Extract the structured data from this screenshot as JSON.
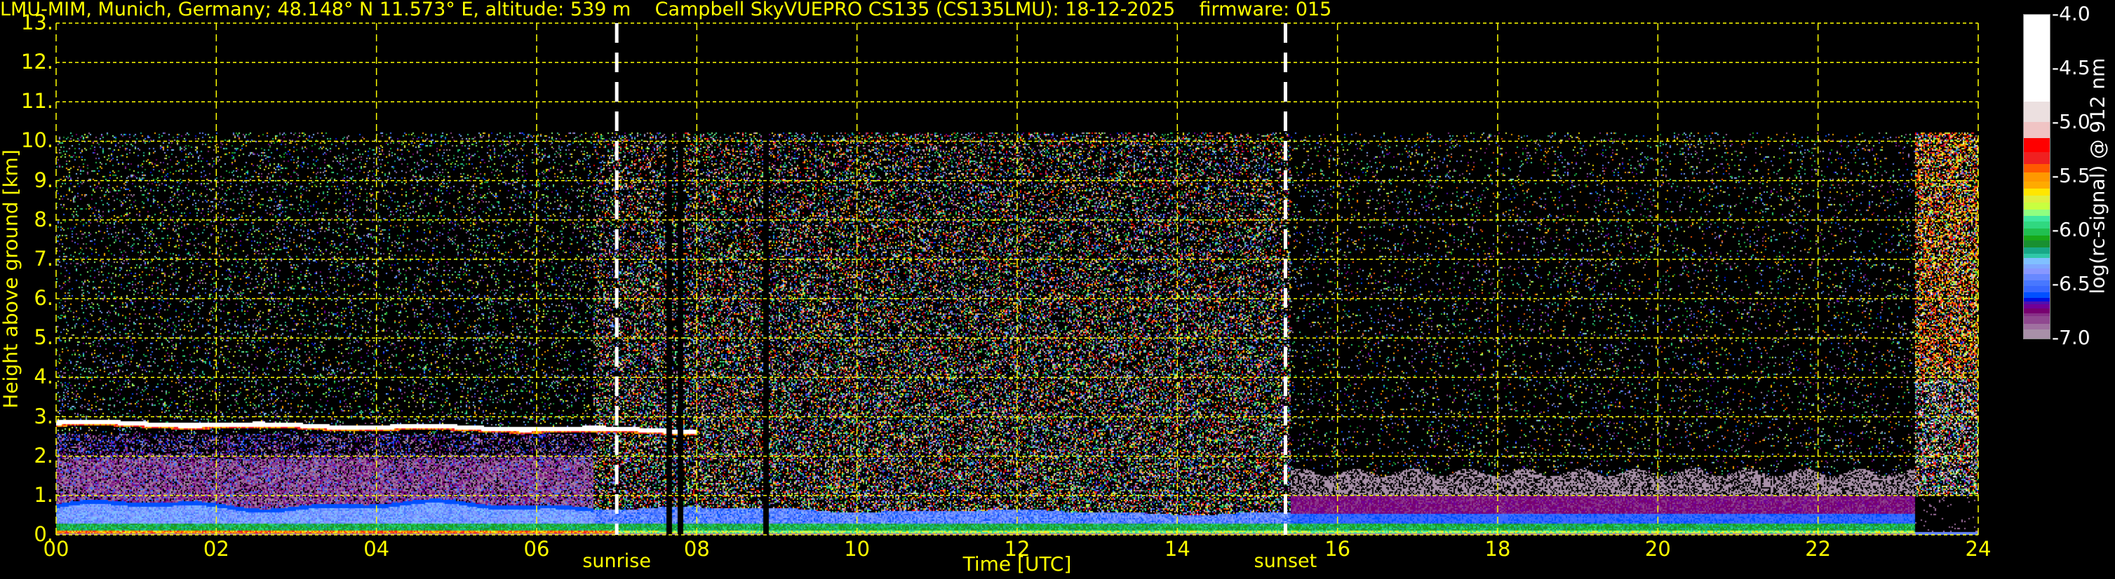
{
  "title": "LMU-MIM, Munich, Germany; 48.148° N 11.573° E, altitude: 539 m    Campbell SkyVUEPRO CS135 (CS135LMU): 18-12-2025    firmware: 015",
  "chart_data": {
    "type": "heatmap",
    "xlabel": "Time [UTC]",
    "ylabel": "Height above ground [km]",
    "xlim": [
      0,
      24
    ],
    "ylim": [
      0,
      13
    ],
    "xticks": [
      "00",
      "02",
      "04",
      "06",
      "08",
      "10",
      "12",
      "14",
      "16",
      "18",
      "20",
      "22",
      "24"
    ],
    "xtick_values": [
      0,
      2,
      4,
      6,
      8,
      10,
      12,
      14,
      16,
      18,
      20,
      22,
      24
    ],
    "yticks": [
      "0.",
      "1.",
      "2.",
      "3.",
      "4.",
      "5.",
      "6.",
      "7.",
      "8.",
      "9.",
      "10.",
      "11.",
      "12.",
      "13."
    ],
    "ytick_values": [
      0,
      1,
      2,
      3,
      4,
      5,
      6,
      7,
      8,
      9,
      10,
      11,
      12,
      13
    ],
    "grid": true,
    "grid_color": "#ffff00",
    "annotations": [
      {
        "label": "sunrise",
        "time_utc": 7.0
      },
      {
        "label": "sunset",
        "time_utc": 15.35
      }
    ],
    "max_range_km": 10.25,
    "cloud_layer": {
      "base_km_start": 2.85,
      "base_km_end": 2.65,
      "from_utc": 0,
      "to_utc": 8.0
    },
    "data_gaps_utc": [
      7.65,
      7.78,
      8.85
    ],
    "colorbar": {
      "label": "log(rc-signal) @ 912 nm",
      "range": [
        -7.0,
        -4.0
      ],
      "ticks": [
        "-4.0",
        "-4.5",
        "-5.0",
        "-5.5",
        "-6.0",
        "-6.5",
        "-7.0"
      ],
      "tick_values": [
        -4.0,
        -4.5,
        -5.0,
        -5.5,
        -6.0,
        -6.5,
        -7.0
      ],
      "levels": [
        {
          "from": -7.0,
          "color": "#a890a8"
        },
        {
          "from": -6.91,
          "color": "#a070a0"
        },
        {
          "from": -6.86,
          "color": "#904890"
        },
        {
          "from": -6.79,
          "color": "#883088"
        },
        {
          "from": -6.76,
          "color": "#780070"
        },
        {
          "from": -6.72,
          "color": "#700098"
        },
        {
          "from": -6.68,
          "color": "#5010b0"
        },
        {
          "from": -6.65,
          "color": "#0010e0"
        },
        {
          "from": -6.62,
          "color": "#0050ff"
        },
        {
          "from": -6.57,
          "color": "#3868ff"
        },
        {
          "from": -6.51,
          "color": "#4878ff"
        },
        {
          "from": -6.46,
          "color": "#6888ff"
        },
        {
          "from": -6.4,
          "color": "#8898ff"
        },
        {
          "from": -6.35,
          "color": "#80a8ff"
        },
        {
          "from": -6.31,
          "color": "#80c0ff"
        },
        {
          "from": -6.25,
          "color": "#30c8a8"
        },
        {
          "from": -6.21,
          "color": "#18a888"
        },
        {
          "from": -6.15,
          "color": "#189030"
        },
        {
          "from": -6.09,
          "color": "#18a818"
        },
        {
          "from": -6.04,
          "color": "#20c050"
        },
        {
          "from": -5.98,
          "color": "#30d880"
        },
        {
          "from": -5.91,
          "color": "#40e8a0"
        },
        {
          "from": -5.86,
          "color": "#90ff80"
        },
        {
          "from": -5.8,
          "color": "#c8ff40"
        },
        {
          "from": -5.74,
          "color": "#e0f040"
        },
        {
          "from": -5.67,
          "color": "#ffe600"
        },
        {
          "from": -5.61,
          "color": "#ffaa00"
        },
        {
          "from": -5.54,
          "color": "#ff9800"
        },
        {
          "from": -5.46,
          "color": "#ff5a00"
        },
        {
          "from": -5.38,
          "color": "#f02020"
        },
        {
          "from": -5.27,
          "color": "#ff0000"
        },
        {
          "from": -5.14,
          "color": "#f0c4c4"
        },
        {
          "from": -4.99,
          "color": "#ece0e0"
        },
        {
          "from": -4.8,
          "color": "#ffffff"
        }
      ]
    }
  }
}
